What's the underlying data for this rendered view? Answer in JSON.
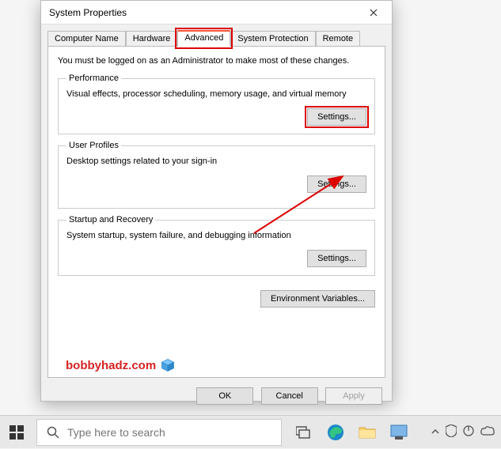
{
  "dialog": {
    "title": "System Properties",
    "tabs": [
      "Computer Name",
      "Hardware",
      "Advanced",
      "System Protection",
      "Remote"
    ],
    "active_tab_index": 2,
    "intro": "You must be logged on as an Administrator to make most of these changes.",
    "groups": {
      "performance": {
        "legend": "Performance",
        "desc": "Visual effects, processor scheduling, memory usage, and virtual memory",
        "button": "Settings..."
      },
      "userprofiles": {
        "legend": "User Profiles",
        "desc": "Desktop settings related to your sign-in",
        "button": "Settings..."
      },
      "startup": {
        "legend": "Startup and Recovery",
        "desc": "System startup, system failure, and debugging information",
        "button": "Settings..."
      }
    },
    "env_button": "Environment Variables...",
    "buttons": {
      "ok": "OK",
      "cancel": "Cancel",
      "apply": "Apply"
    }
  },
  "watermark": {
    "text": "bobbyhadz.com"
  },
  "taskbar": {
    "search_placeholder": "Type here to search"
  }
}
